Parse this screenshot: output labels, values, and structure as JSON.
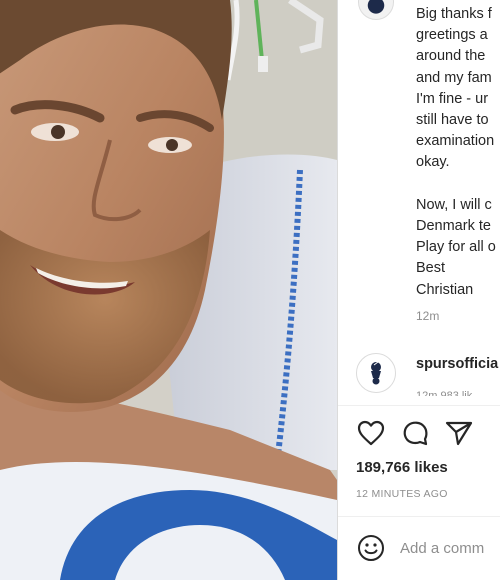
{
  "post": {
    "caption": "Big thanks f\ngreetings a\naround the\nand my fam\nI'm fine - ur\nstill have to\nexamination\nokay.\n\nNow, I will c\nDenmark te\nPlay for all o\nBest\nChristian",
    "caption_time": "12m",
    "likes": "189,766 likes",
    "posted_ago": "12 MINUTES AGO"
  },
  "comment": {
    "username": "spursofficia",
    "meta": "12m   983 lik"
  },
  "comment_box": {
    "placeholder": "Add a comm"
  },
  "icons": {
    "like": "heart-icon",
    "comment": "comment-bubble-icon",
    "share": "paper-plane-icon",
    "emoji": "smiley-icon",
    "comment_avatar": "spurs-cockerel-icon"
  },
  "colors": {
    "text": "#262626",
    "muted": "#8e8e8e",
    "border": "#dbdbdb",
    "bedsheet_blue": "#2b63b8"
  }
}
